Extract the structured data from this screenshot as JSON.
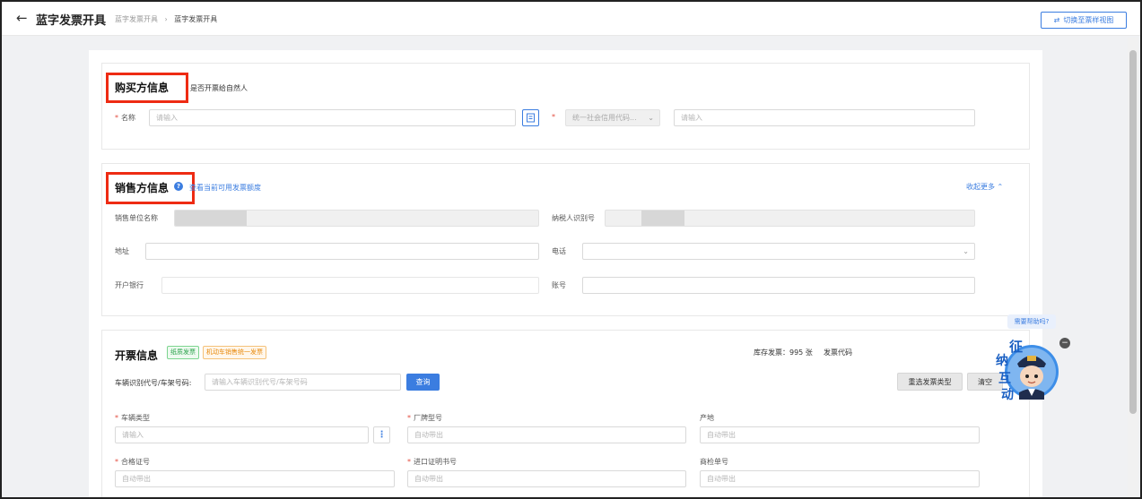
{
  "header": {
    "title": "蓝字发票开具",
    "breadcrumb": [
      "蓝字发票开具",
      "蓝字发票开具"
    ],
    "switch_label": "切换至票样视图"
  },
  "buyer": {
    "title": "购买方信息",
    "natural_person": "是否开票给自然人",
    "name_label": "名称",
    "name_placeholder": "请输入",
    "code_select": "统一社会信用代码...",
    "code_placeholder": "请输入"
  },
  "seller": {
    "title": "销售方信息",
    "quota_link": "查看当前可用发票额度",
    "collapse": "收起更多",
    "name_label": "销售单位名称",
    "taxid_label": "纳税人识别号",
    "address_label": "地址",
    "phone_label": "电话",
    "bank_label": "开户银行",
    "account_label": "账号"
  },
  "invoice": {
    "title": "开票信息",
    "tag_paper": "纸质发票",
    "tag_type": "机动车销售统一发票",
    "stock": "库存发票：995 张",
    "invoice_code": "发票代码",
    "vin_label": "车辆识别代号/车架号码:",
    "vin_placeholder": "请输入车辆识别代号/车架号码",
    "query_btn": "查询",
    "reselect_btn": "重选发票类型",
    "clear_btn": "清空",
    "fields": {
      "vehicle_type": "车辆类型",
      "vehicle_type_ph": "请输入",
      "brand_model": "厂牌型号",
      "brand_model_ph": "自动带出",
      "origin": "产地",
      "origin_ph": "自动带出",
      "cert_no": "合格证号",
      "cert_no_ph": "自动带出",
      "import_cert": "进口证明书号",
      "import_cert_ph": "自动带出",
      "inspect_no": "商检单号",
      "inspect_no_ph": "自动带出"
    }
  },
  "helper": {
    "bubble": "需要帮助吗?",
    "mascot_text": [
      "征",
      "纳",
      "互",
      "动"
    ]
  },
  "colors": {
    "accent": "#3b7de0",
    "highlight_box": "#ee2b13",
    "required": "#e34d3f"
  }
}
